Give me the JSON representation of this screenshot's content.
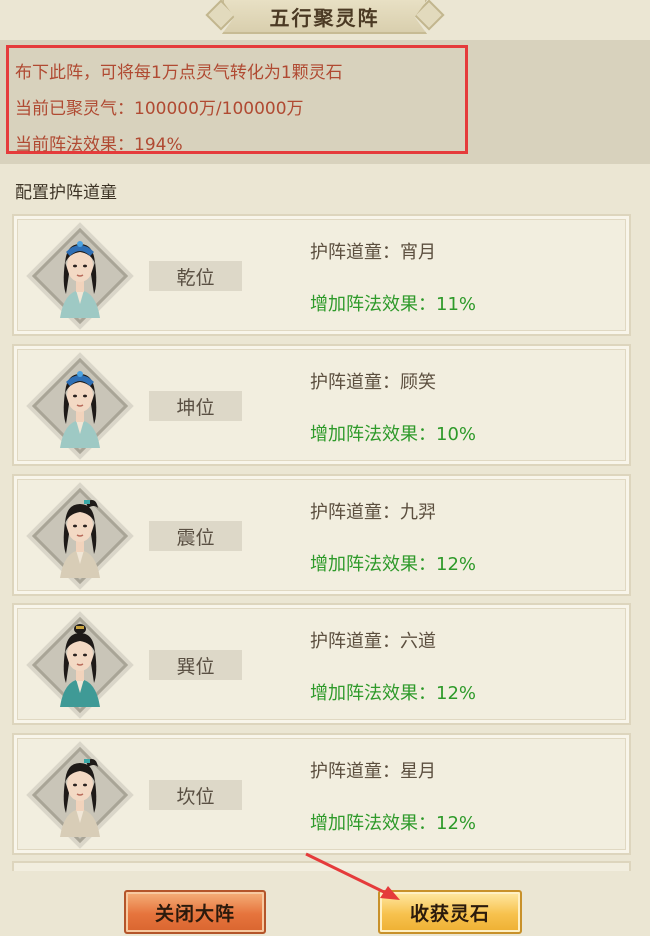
{
  "title": "五行聚灵阵",
  "info": {
    "line1": "布下此阵，可将每1万点灵气转化为1颗灵石",
    "line2": "当前已聚灵气：100000万/100000万",
    "line3": "当前阵法效果：194%"
  },
  "section_title": "配置护阵道童",
  "guards": [
    {
      "position": "乾位",
      "name": "护阵道童：宵月",
      "bonus": "增加阵法效果：11%",
      "hair": "female-blue-crown"
    },
    {
      "position": "坤位",
      "name": "护阵道童：顾笑",
      "bonus": "增加阵法效果：10%",
      "hair": "female-blue-crown"
    },
    {
      "position": "震位",
      "name": "护阵道童：九羿",
      "bonus": "增加阵法效果：12%",
      "hair": "male-ponytail"
    },
    {
      "position": "巽位",
      "name": "护阵道童：六道",
      "bonus": "增加阵法效果：12%",
      "hair": "male-topknot"
    },
    {
      "position": "坎位",
      "name": "护阵道童：星月",
      "bonus": "增加阵法效果：12%",
      "hair": "male-ponytail"
    }
  ],
  "buttons": {
    "close": "关闭大阵",
    "harvest": "收获灵石"
  },
  "colors": {
    "highlight_border": "#e53b3b",
    "bonus_text": "#2e9a2a",
    "info_text": "#b04a32",
    "arrow": "#e53b3b"
  }
}
